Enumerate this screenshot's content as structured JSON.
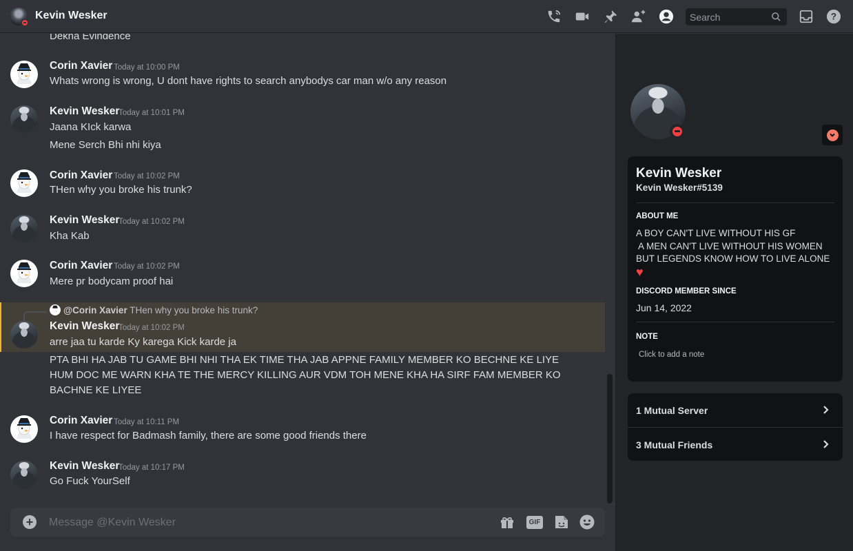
{
  "header": {
    "dm_name": "Kevin Wesker",
    "search_placeholder": "Search",
    "icons": [
      "phone-call-icon",
      "video-camera-icon",
      "pin-icon",
      "add-friend-icon",
      "profile-icon",
      "search-icon",
      "inbox-icon",
      "help-icon"
    ]
  },
  "messages": [
    {
      "author": "",
      "time": "",
      "lines": [
        "Dekha Evindence"
      ]
    },
    {
      "author": "Corin Xavier",
      "time": "Today at 10:00 PM",
      "lines": [
        "Whats wrong is wrong, U dont have rights to search anybodys car man w/o any reason"
      ]
    },
    {
      "author": "Kevin Wesker",
      "time": "Today at 10:01 PM",
      "lines": [
        "Jaana KIck karwa",
        "Mene Serch Bhi nhi kiya"
      ]
    },
    {
      "author": "Corin Xavier",
      "time": "Today at 10:02 PM",
      "lines": [
        "THen why you broke his trunk?"
      ]
    },
    {
      "author": "Kevin Wesker",
      "time": "Today at 10:02 PM",
      "lines": [
        "Kha Kab"
      ]
    },
    {
      "author": "Corin Xavier",
      "time": "Today at 10:02 PM",
      "lines": [
        "Mere pr bodycam proof hai"
      ]
    },
    {
      "author": "Kevin Wesker",
      "time": "Today at 10:02 PM",
      "reply": {
        "author": "@Corin Xavier",
        "text": "THen why you broke his trunk?"
      },
      "lines": [
        "arre jaa tu karde Ky karega Kick karde ja",
        "PTA BHI HA JAB TU GAME BHI NHI THA EK TIME THA JAB APPNE FAMILY MEMBER KO BECHNE KE LIYE",
        "HUM DOC ME WARN KHA TE THE MERCY KILLING AUR VDM TOH MENE KHA HA SIRF FAM MEMBER KO",
        "BACHNE KE LIYEE"
      ]
    },
    {
      "author": "Corin Xavier",
      "time": "Today at 10:11 PM",
      "lines": [
        "I have respect for Badmash family, there are some good friends there"
      ]
    },
    {
      "author": "Kevin Wesker",
      "time": "Today at 10:17 PM",
      "lines": [
        "Go Fuck YourSelf"
      ]
    }
  ],
  "composer": {
    "placeholder": "Message @Kevin Wesker",
    "add_label": "+",
    "gif_label": "GIF"
  },
  "profile": {
    "display_name": "Kevin Wesker",
    "tag": "Kevin Wesker#5139",
    "status": "do-not-disturb",
    "about_heading": "ABOUT ME",
    "about_lines": [
      "A BOY CAN'T LIVE WITHOUT HIS GF",
      " A MEN CAN'T LIVE WITHOUT HIS WOMEN",
      "BUT LEGENDS KNOW HOW TO LIVE ALONE"
    ],
    "about_emoji": "♥",
    "since_heading": "DISCORD MEMBER SINCE",
    "since_date": "Jun 14, 2022",
    "note_heading": "NOTE",
    "note_placeholder": "Click to add a note"
  },
  "mutuals": {
    "servers": "1 Mutual Server",
    "friends": "3 Mutual Friends"
  },
  "colors": {
    "background": "#313338",
    "panel": "#232428",
    "card": "#111214",
    "dnd_red": "#f23f43",
    "mention_highlight": "#f0b232",
    "nitro_coral": "#f47b67"
  }
}
